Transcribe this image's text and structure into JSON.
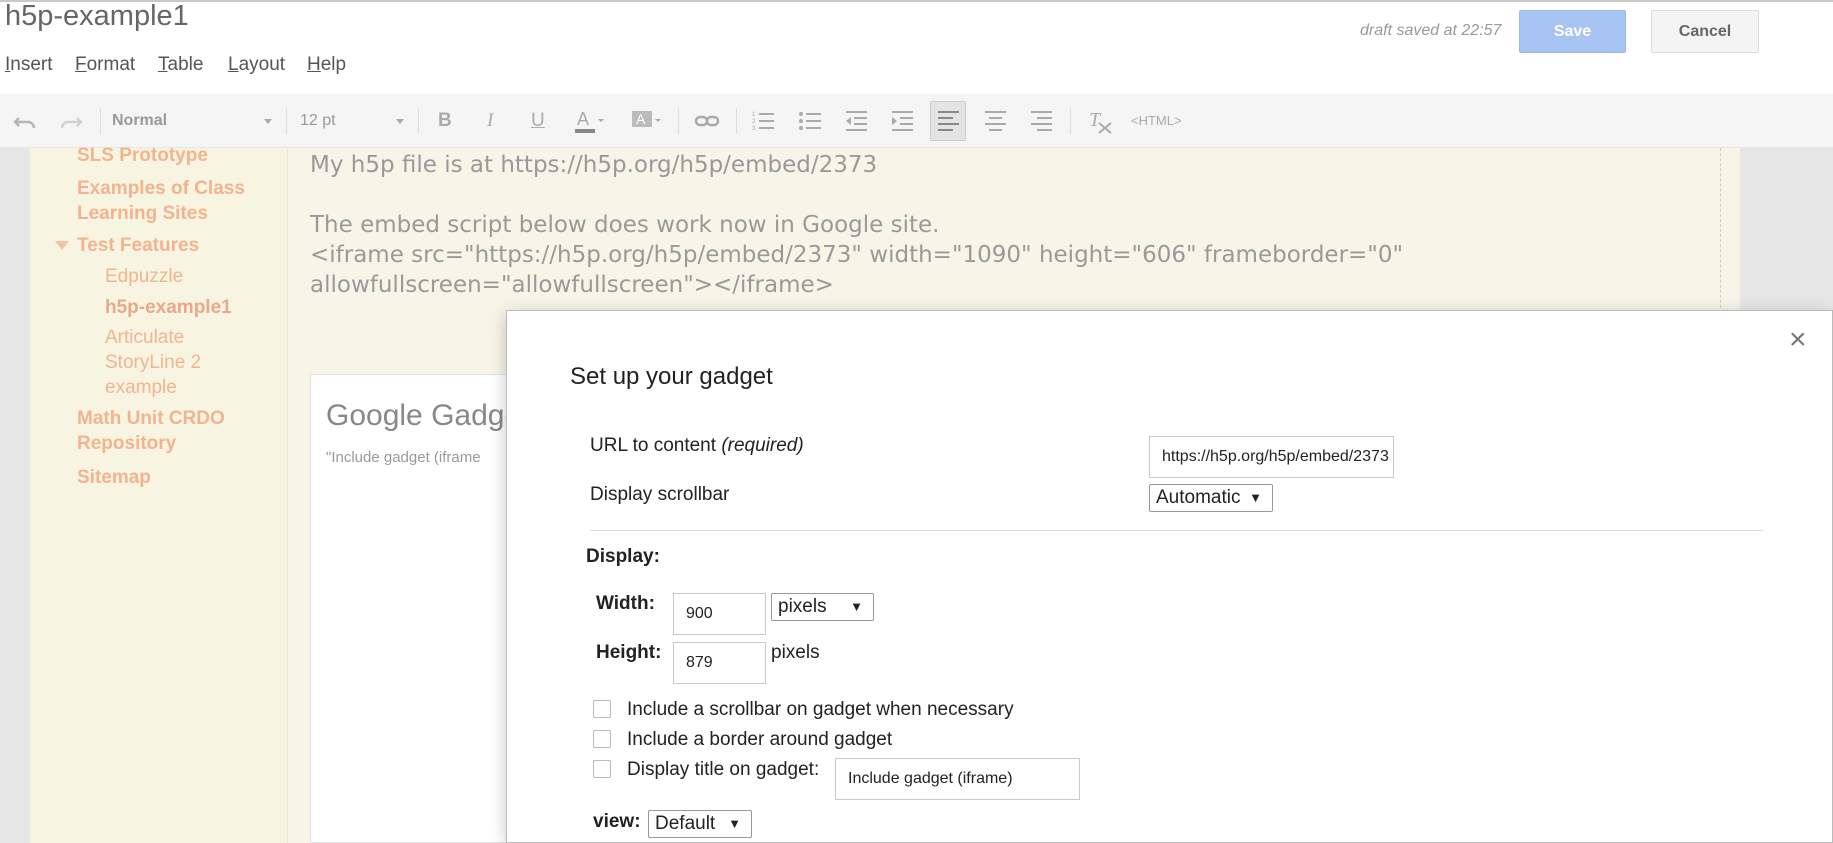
{
  "header": {
    "page_title": "h5p-example1",
    "draft_status": "draft saved at 22:57",
    "save_label": "Save",
    "cancel_label": "Cancel"
  },
  "menu": [
    "Insert",
    "Format",
    "Table",
    "Layout",
    "Help"
  ],
  "toolbar": {
    "style_select": "Normal",
    "size_select": "12 pt",
    "html_label": "<HTML>",
    "icons": [
      "undo-icon",
      "redo-icon",
      "bold-icon",
      "italic-icon",
      "underline-icon",
      "text-color-icon",
      "highlight-color-icon",
      "link-icon",
      "numbered-list-icon",
      "bullet-list-icon",
      "decrease-indent-icon",
      "increase-indent-icon",
      "align-left-icon",
      "align-center-icon",
      "align-right-icon",
      "clear-formatting-icon"
    ]
  },
  "sidebar": {
    "items": [
      {
        "label": "SLS Prototype"
      },
      {
        "label": "Examples of Class Learning Sites"
      },
      {
        "label": "Test Features"
      },
      {
        "label": "Edpuzzle"
      },
      {
        "label": "h5p-example1"
      },
      {
        "label": "Articulate StoryLine 2 example"
      },
      {
        "label": "Math Unit CRDO Repository"
      },
      {
        "label": "Sitemap"
      }
    ]
  },
  "content": {
    "line1": "My h5p file is at https://h5p.org/h5p/embed/2373",
    "line2": "The embed script below does work now in Google site.",
    "line3": "<iframe src=\"https://h5p.org/h5p/embed/2373\" width=\"1090\" height=\"606\" frameborder=\"0\"",
    "line4": "allowfullscreen=\"allowfullscreen\"></iframe>",
    "gadget_title": "Google Gadge",
    "gadget_sub": "\"Include gadget (iframe"
  },
  "dialog": {
    "title": "Set up your gadget",
    "close": "×",
    "url_label": "URL to content",
    "url_required": "(required)",
    "url_value": "https://h5p.org/h5p/embed/2373",
    "scrollbar_label": "Display scrollbar",
    "scrollbar_value": "Automatic",
    "display_label": "Display:",
    "width_label": "Width:",
    "width_value": "900",
    "width_unit": "pixels",
    "height_label": "Height:",
    "height_value": "879",
    "height_unit": "pixels",
    "chk_scrollbar": "Include a scrollbar on gadget when necessary",
    "chk_border": "Include a border around gadget",
    "chk_title": "Display title on gadget:",
    "title_value": "Include gadget (iframe)",
    "view_label": "view:",
    "view_value": "Default",
    "arrow": "▼"
  }
}
